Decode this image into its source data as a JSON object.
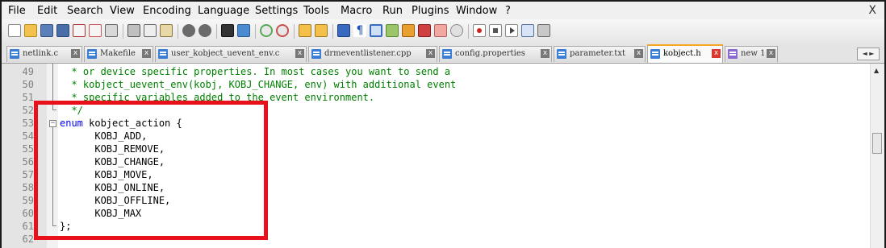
{
  "menu": {
    "items": [
      "File",
      "Edit",
      "Search",
      "View",
      "Encoding",
      "Language",
      "Settings",
      "Tools",
      "Macro",
      "Run",
      "Plugins",
      "Window",
      "?"
    ],
    "close": "X"
  },
  "toolbar": {
    "icons": [
      "new-file-icon",
      "open-file-icon",
      "save-icon",
      "save-all-icon",
      "close-icon",
      "close-all-icon",
      "print-icon",
      "cut-icon",
      "copy-icon",
      "paste-icon",
      "undo-icon",
      "redo-icon",
      "find-icon",
      "replace-icon",
      "zoom-in-icon",
      "zoom-out-icon",
      "sync-v-icon",
      "sync-h-icon",
      "word-wrap-icon",
      "show-all-chars-icon",
      "indent-guide-icon",
      "language-icon",
      "function-list-icon",
      "folder-icon",
      "monitor-icon",
      "record-macro-icon",
      "stop-record-icon",
      "play-macro-icon",
      "run-macro-multiple-icon",
      "save-macro-icon"
    ]
  },
  "tabs": [
    {
      "label": "netlink.c",
      "active": false
    },
    {
      "label": "Makefile",
      "active": false
    },
    {
      "label": "user_kobject_uevent_env.c",
      "active": false
    },
    {
      "label": "drmeventlistener.cpp",
      "active": false
    },
    {
      "label": "config.properties",
      "active": false
    },
    {
      "label": "parameter.txt",
      "active": false
    },
    {
      "label": "kobject.h",
      "active": true
    },
    {
      "label": "new 1",
      "active": false
    }
  ],
  "tab_close_glyph": "x",
  "editor": {
    "lines": [
      {
        "num": "49",
        "text": "  * or device specific properties. In most cases you want to send a",
        "type": "comment"
      },
      {
        "num": "50",
        "text": "  * kobject_uevent_env(kobj, KOBJ_CHANGE, env) with additional event",
        "type": "comment"
      },
      {
        "num": "51",
        "text": "  * specific variables added to the event environment.",
        "type": "comment"
      },
      {
        "num": "52",
        "text": "  */",
        "type": "comment"
      },
      {
        "num": "53",
        "kw": "enum",
        "text": " kobject_action {",
        "type": "enum"
      },
      {
        "num": "54",
        "text": "      KOBJ_ADD,",
        "type": "plain"
      },
      {
        "num": "55",
        "text": "      KOBJ_REMOVE,",
        "type": "plain"
      },
      {
        "num": "56",
        "text": "      KOBJ_CHANGE,",
        "type": "plain"
      },
      {
        "num": "57",
        "text": "      KOBJ_MOVE,",
        "type": "plain"
      },
      {
        "num": "58",
        "text": "      KOBJ_ONLINE,",
        "type": "plain"
      },
      {
        "num": "59",
        "text": "      KOBJ_OFFLINE,",
        "type": "plain"
      },
      {
        "num": "60",
        "text": "      KOBJ_MAX",
        "type": "plain"
      },
      {
        "num": "61",
        "text": "};",
        "type": "plain"
      },
      {
        "num": "62",
        "text": "",
        "type": "plain"
      }
    ]
  },
  "colors": {
    "comment": "#008000",
    "keyword": "#0000ff",
    "highlight_box": "#e8101a",
    "active_tab_accent": "#f5a623"
  }
}
